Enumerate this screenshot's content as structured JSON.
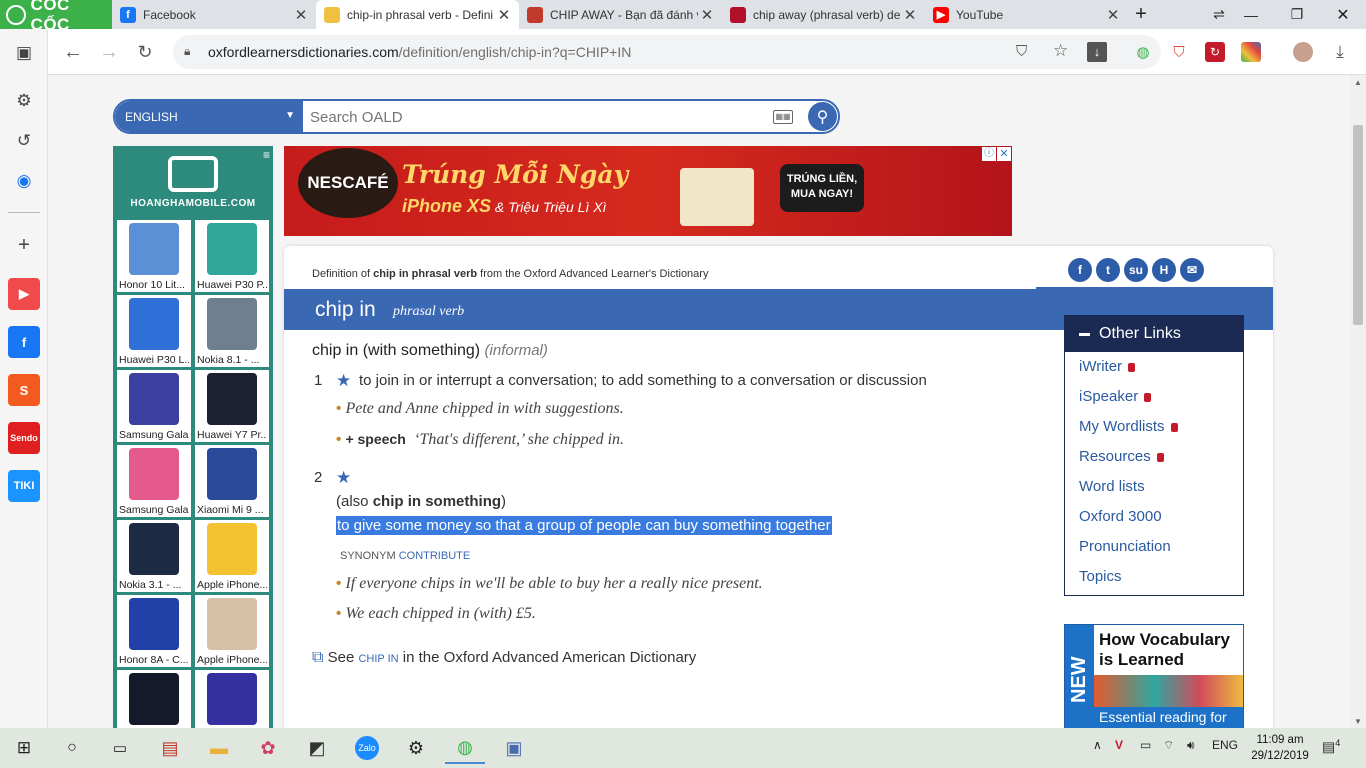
{
  "brand": {
    "name": "CỐC CỐC"
  },
  "tabs": [
    {
      "label": "Facebook",
      "icon": "facebook-icon",
      "color": "#1877f2",
      "active": false
    },
    {
      "label": "chip-in phrasal verb - Defini",
      "icon": "oxford-icon",
      "color": "#6b8e23",
      "active": true
    },
    {
      "label": "CHIP AWAY - Bạn đã đánh v",
      "icon": "cambridge-icon",
      "color": "#c0392b",
      "active": false
    },
    {
      "label": "chip away (phrasal verb) de",
      "icon": "macmillan-icon",
      "color": "#b0102a",
      "active": false
    },
    {
      "label": "YouTube",
      "icon": "youtube-icon",
      "color": "#ff0000",
      "active": false
    }
  ],
  "toolbar": {
    "url_domain": "oxfordlearnersdictionaries.com",
    "url_path": "/definition/english/chip-in?q=CHIP+IN"
  },
  "search": {
    "dictionary": "ENGLISH",
    "placeholder": "Search OALD"
  },
  "left_ad": {
    "logo_text": "HOANGHAMOBILE.COM",
    "phones": [
      {
        "name": "Honor 10 Lit...",
        "color": "#5b8fd6"
      },
      {
        "name": "Huawei P30 P...",
        "color": "#2fa89a"
      },
      {
        "name": "Huawei P30 L...",
        "color": "#2e6fd8"
      },
      {
        "name": "Nokia 8.1 - ...",
        "color": "#6f7f8f"
      },
      {
        "name": "Samsung Gala...",
        "color": "#3b3fa0"
      },
      {
        "name": "Huawei Y7 Pr...",
        "color": "#1c2030"
      },
      {
        "name": "Samsung Gala...",
        "color": "#e45a8c"
      },
      {
        "name": "Xiaomi Mi 9 ...",
        "color": "#2a4a9a"
      },
      {
        "name": "Nokia 3.1 - ...",
        "color": "#1d2a44"
      },
      {
        "name": "Apple iPhone...",
        "color": "#f2c230"
      },
      {
        "name": "Honor 8A - C...",
        "color": "#2140a8"
      },
      {
        "name": "Apple iPhone...",
        "color": "#d7c2a8"
      },
      {
        "name": "",
        "color": "#151a2a"
      },
      {
        "name": "",
        "color": "#3530a0"
      }
    ]
  },
  "top_ad": {
    "brand": "NESCAFÉ",
    "slogan": "Trúng Mỗi Ngày",
    "prize_main": "iPhone XS",
    "prize_rest": "& Triệu Triệu Lì Xì",
    "cta_line1": "TRÚNG LIỀN,",
    "cta_line2": "MUA NGAY!"
  },
  "entry": {
    "source_prefix": "Definition of",
    "source_term": "chip in phrasal verb",
    "source_suffix": "from the Oxford Advanced Learner's Dictionary",
    "headword": "chip in",
    "pos": "phrasal verb",
    "phrase": "chip in (with something)",
    "register": "informal",
    "senses": [
      {
        "num": "1",
        "definition": "to join in or interrupt a conversation; to add something to a conversation or discussion",
        "examples": [
          "Pete and Anne chipped in with suggestions.",
          "‘That's different,’ she chipped in."
        ],
        "example2_label": "+ speech"
      },
      {
        "num": "2",
        "also_prefix": "(also",
        "also_term": "chip in something",
        "also_suffix": ")",
        "definition": "to give some money so that a group of people can buy something together",
        "synonym_label": "SYNONYM",
        "synonym": "CONTRIBUTE",
        "examples": [
          "If everyone chips in we'll be able to buy her a really nice present.",
          "We each chipped in (with) £5."
        ]
      }
    ],
    "see_prefix": "See",
    "see_term": "CHIP IN",
    "see_suffix": "in the Oxford Advanced American Dictionary"
  },
  "other_links": {
    "title": "Other Links",
    "items": [
      "iWriter",
      "iSpeaker",
      "My Wordlists",
      "Resources",
      "Word lists",
      "Oxford 3000",
      "Pronunciation",
      "Topics"
    ]
  },
  "vocab_ad": {
    "badge": "NEW",
    "title_line1": "How Vocabulary",
    "title_line2": "is Learned",
    "foot": "Essential reading for"
  },
  "taskbar": {
    "lang": "ENG",
    "time": "11:09 am",
    "date": "29/12/2019",
    "notifications": "4",
    "zalo_label": "Zalo"
  },
  "colors": {
    "accent": "#3a68b3",
    "brand_green": "#3cb14a",
    "sidebar_dark": "#1a2a52",
    "selection": "#3a7be0"
  }
}
